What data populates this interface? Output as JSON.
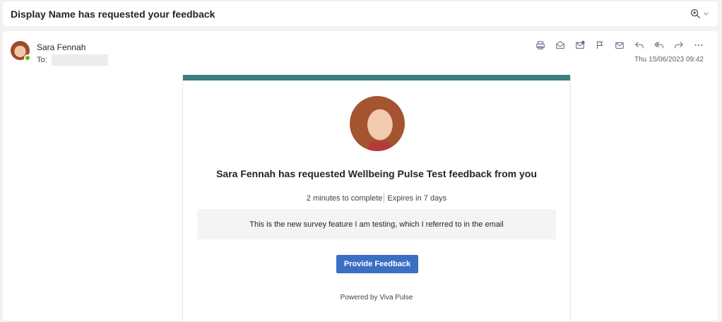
{
  "subject": {
    "title": "Display Name has requested your feedback",
    "zoom_icon": "zoom-in-icon",
    "dropdown_icon": "chevron-down-icon"
  },
  "message": {
    "sender_name": "Sara Fennah",
    "to_label": "To:",
    "timestamp": "Thu 15/06/2023 09:42",
    "presence_color": "#6bb700",
    "actions": [
      {
        "icon": "print-icon"
      },
      {
        "icon": "mark-read-icon"
      },
      {
        "icon": "mark-unread-icon"
      },
      {
        "icon": "flag-icon"
      },
      {
        "icon": "mail-icon"
      },
      {
        "icon": "reply-icon"
      },
      {
        "icon": "reply-all-icon"
      },
      {
        "icon": "forward-icon"
      },
      {
        "icon": "more-icon"
      }
    ]
  },
  "card": {
    "accent_color": "#3b7f7f",
    "title": "Sara Fennah has requested Wellbeing Pulse Test feedback from you",
    "duration": "2 minutes to complete",
    "expiry": "Expires in 7 days",
    "note": "This is the new survey feature I am testing, which I referred to in the email",
    "button_label": "Provide Feedback",
    "button_color": "#3a6fc4",
    "footer": "Powered by Viva Pulse"
  }
}
